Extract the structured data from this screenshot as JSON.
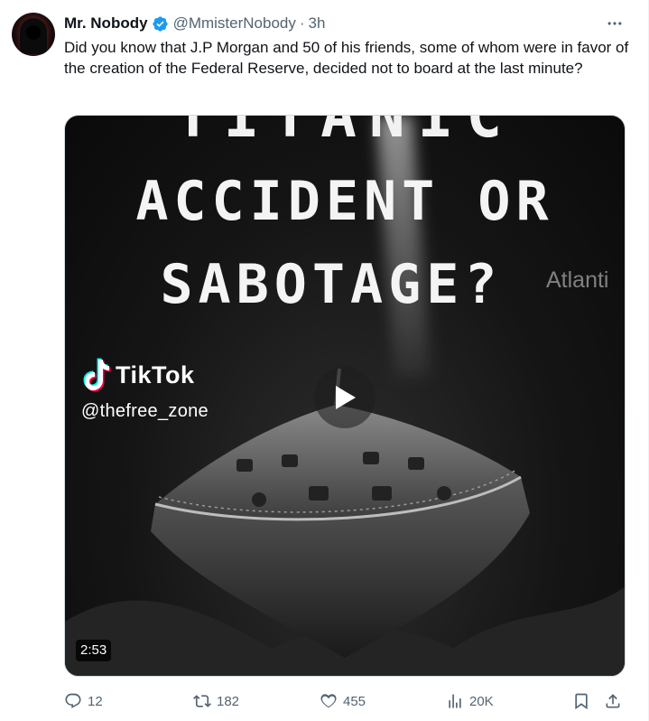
{
  "author": {
    "name": "Mr. Nobody",
    "handle": "@MmisterNobody",
    "separator": "·",
    "time": "3h"
  },
  "tweet_text": "Did you know that J.P Morgan and 50 of his friends, some of whom were in favor of the creation of the Federal Reserve, decided not to board at the last minute?",
  "video": {
    "title_top": "TITANIC",
    "title_line1": "ACCIDENT OR",
    "title_line2": "SABOTAGE?",
    "side_watermark": "Atlanti",
    "watermark_brand": "TikTok",
    "watermark_user": "@thefree_zone",
    "duration": "2:53"
  },
  "actions": {
    "replies": "12",
    "reposts": "182",
    "likes": "455",
    "views": "20K"
  },
  "colors": {
    "verified": "#1d9bf0",
    "muted": "#536471"
  },
  "icons": [
    "more-icon",
    "verified-icon",
    "play-icon",
    "reply-icon",
    "repost-icon",
    "like-icon",
    "views-icon",
    "bookmark-icon",
    "share-icon"
  ]
}
